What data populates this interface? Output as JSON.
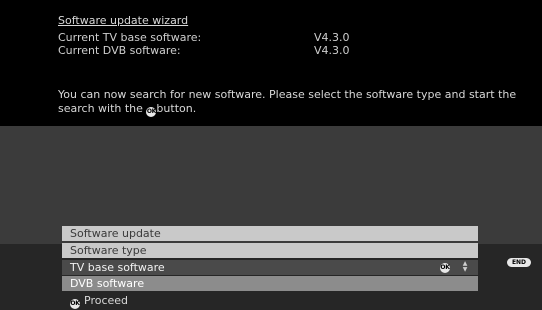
{
  "wizard": {
    "title": "Software update wizard",
    "tv_label": "Current TV base software:",
    "tv_version": "V4.3.0",
    "dvb_label": "Current DVB software:",
    "dvb_version": "V4.3.0",
    "message_part1": "You can now search for new software. Please select the software type and start the search with the ",
    "message_part2": "button."
  },
  "menu": {
    "header": "Software update",
    "type_label": "Software type",
    "selected_value": "TV base software",
    "option": "DVB software",
    "proceed_label": "Proceed"
  },
  "icons": {
    "ok": "OK",
    "end": "END"
  },
  "colors": {
    "background_top": "#000000",
    "background_middle": "#3b3b3b",
    "background_bottom": "#262626",
    "menu_light": "#c9c9c9",
    "menu_selected": "#4a4a4a",
    "menu_option": "#8c8c8c"
  }
}
